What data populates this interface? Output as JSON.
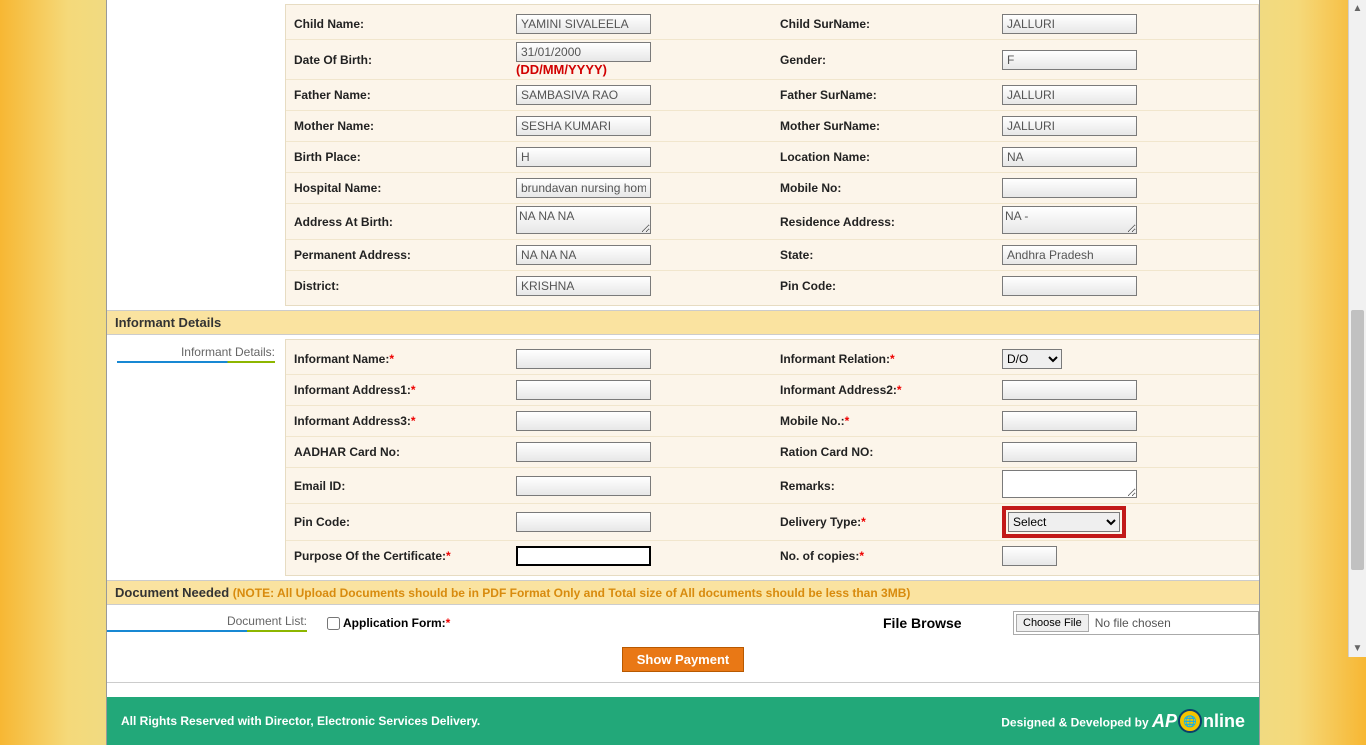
{
  "child": {
    "name_label": "Child Name:",
    "name": "YAMINI SIVALEELA",
    "surname_label": "Child SurName:",
    "surname": "JALLURI",
    "dob_label": "Date Of Birth:",
    "dob": "31/01/2000",
    "dob_hint": "(DD/MM/YYYY)",
    "gender_label": "Gender:",
    "gender": "F",
    "father_label": "Father Name:",
    "father": "SAMBASIVA RAO",
    "father_sur_label": "Father SurName:",
    "father_sur": "JALLURI",
    "mother_label": "Mother Name:",
    "mother": "SESHA KUMARI",
    "mother_sur_label": "Mother SurName:",
    "mother_sur": "JALLURI",
    "birth_place_label": "Birth Place:",
    "birth_place": "H",
    "location_label": "Location Name:",
    "location": "NA",
    "hospital_label": "Hospital Name:",
    "hospital": "brundavan nursing home",
    "mobile_label": "Mobile No:",
    "mobile": "",
    "address_birth_label": "Address At Birth:",
    "address_birth": "NA NA NA",
    "residence_label": "Residence Address:",
    "residence": "NA -",
    "perm_addr_label": "Permanent Address:",
    "perm_addr": "NA NA NA",
    "state_label": "State:",
    "state": "Andhra Pradesh",
    "district_label": "District:",
    "district": "KRISHNA",
    "pin_label": "Pin Code:",
    "pin": ""
  },
  "inf": {
    "section_title": "Informant Details",
    "side_label": "Informant Details:",
    "name_label": "Informant Name:",
    "relation_label": "Informant Relation:",
    "relation_value": "D/O",
    "addr1_label": "Informant Address1:",
    "addr2_label": "Informant Address2:",
    "addr3_label": "Informant Address3:",
    "mobile_label": "Mobile No.:",
    "aadhar_label": "AADHAR Card No:",
    "ration_label": "Ration Card NO:",
    "email_label": "Email ID:",
    "remarks_label": "Remarks:",
    "pin_label": "Pin Code:",
    "delivery_label": "Delivery Type:",
    "delivery_value": "Select",
    "purpose_label": "Purpose Of the Certificate:",
    "copies_label": "No. of copies:"
  },
  "doc": {
    "section_title": "Document Needed ",
    "note": "(NOTE: All Upload Documents should be in PDF Format Only and Total size of All documents should be less than 3MB)",
    "side_label": "Document List:",
    "app_form_label": "Application Form:",
    "file_browse_label": "File Browse",
    "choose_file": "Choose File",
    "no_file": "No file chosen"
  },
  "btn": {
    "show_payment": "Show Payment"
  },
  "footer": {
    "left": "All Rights Reserved with Director, Electronic Services Delivery.",
    "right": "Designed & Developed by",
    "brand1": "AP",
    "brand2": "nline"
  }
}
